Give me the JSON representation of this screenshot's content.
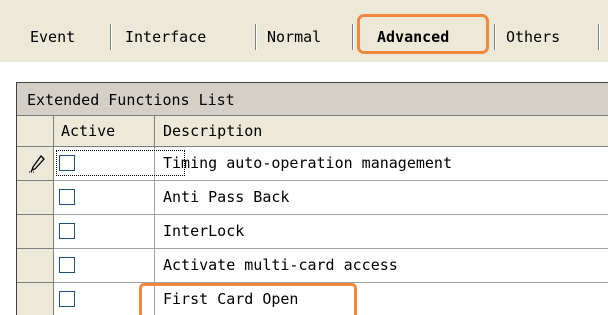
{
  "tabs": [
    {
      "label": "Event"
    },
    {
      "label": "Interface"
    },
    {
      "label": "Normal"
    },
    {
      "label": "Advanced"
    },
    {
      "label": "Others"
    }
  ],
  "active_tab": "Advanced",
  "grid": {
    "caption": "Extended Functions List",
    "columns": [
      "Active",
      "Description"
    ],
    "rows": [
      {
        "active": false,
        "description": "Timing auto-operation management",
        "editing": true
      },
      {
        "active": false,
        "description": "Anti Pass Back"
      },
      {
        "active": false,
        "description": "InterLock"
      },
      {
        "active": false,
        "description": "Activate multi-card access"
      },
      {
        "active": false,
        "description": "First Card Open",
        "highlighted": true
      }
    ]
  },
  "colors": {
    "highlight": "#f0893c",
    "tab_background": "#ece9d8",
    "header_background": "#ece9d8"
  },
  "icons": {
    "edit_row_indicator": "pencil-icon"
  }
}
